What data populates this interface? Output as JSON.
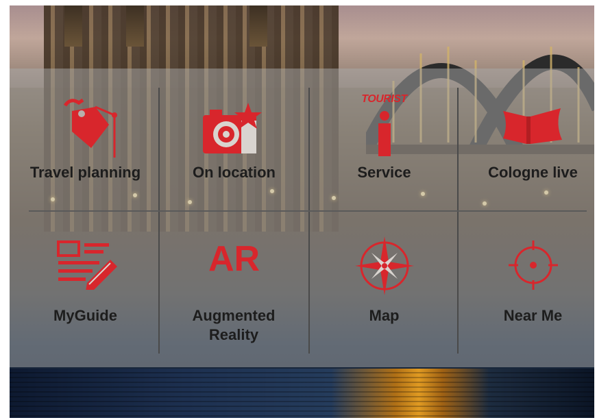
{
  "menu": {
    "row1": [
      {
        "label": "Travel planning",
        "icon": "luggage-tag-icon"
      },
      {
        "label": "On location",
        "icon": "camera-icon"
      },
      {
        "label": "Service",
        "icon": "tourist-info-icon",
        "icon_text": "TOURIST"
      },
      {
        "label": "Cologne live",
        "icon": "ticket-icon"
      }
    ],
    "row2": [
      {
        "label": "MyGuide",
        "icon": "notes-pencil-icon"
      },
      {
        "label": "Augmented Reality",
        "icon": "ar-icon",
        "icon_text": "AR"
      },
      {
        "label": "Map",
        "icon": "compass-rose-icon"
      },
      {
        "label": "Near Me",
        "icon": "crosshair-icon"
      }
    ]
  },
  "colors": {
    "accent": "#d8262c",
    "label": "#1d1d1d",
    "divider": "#4a4a4a"
  }
}
